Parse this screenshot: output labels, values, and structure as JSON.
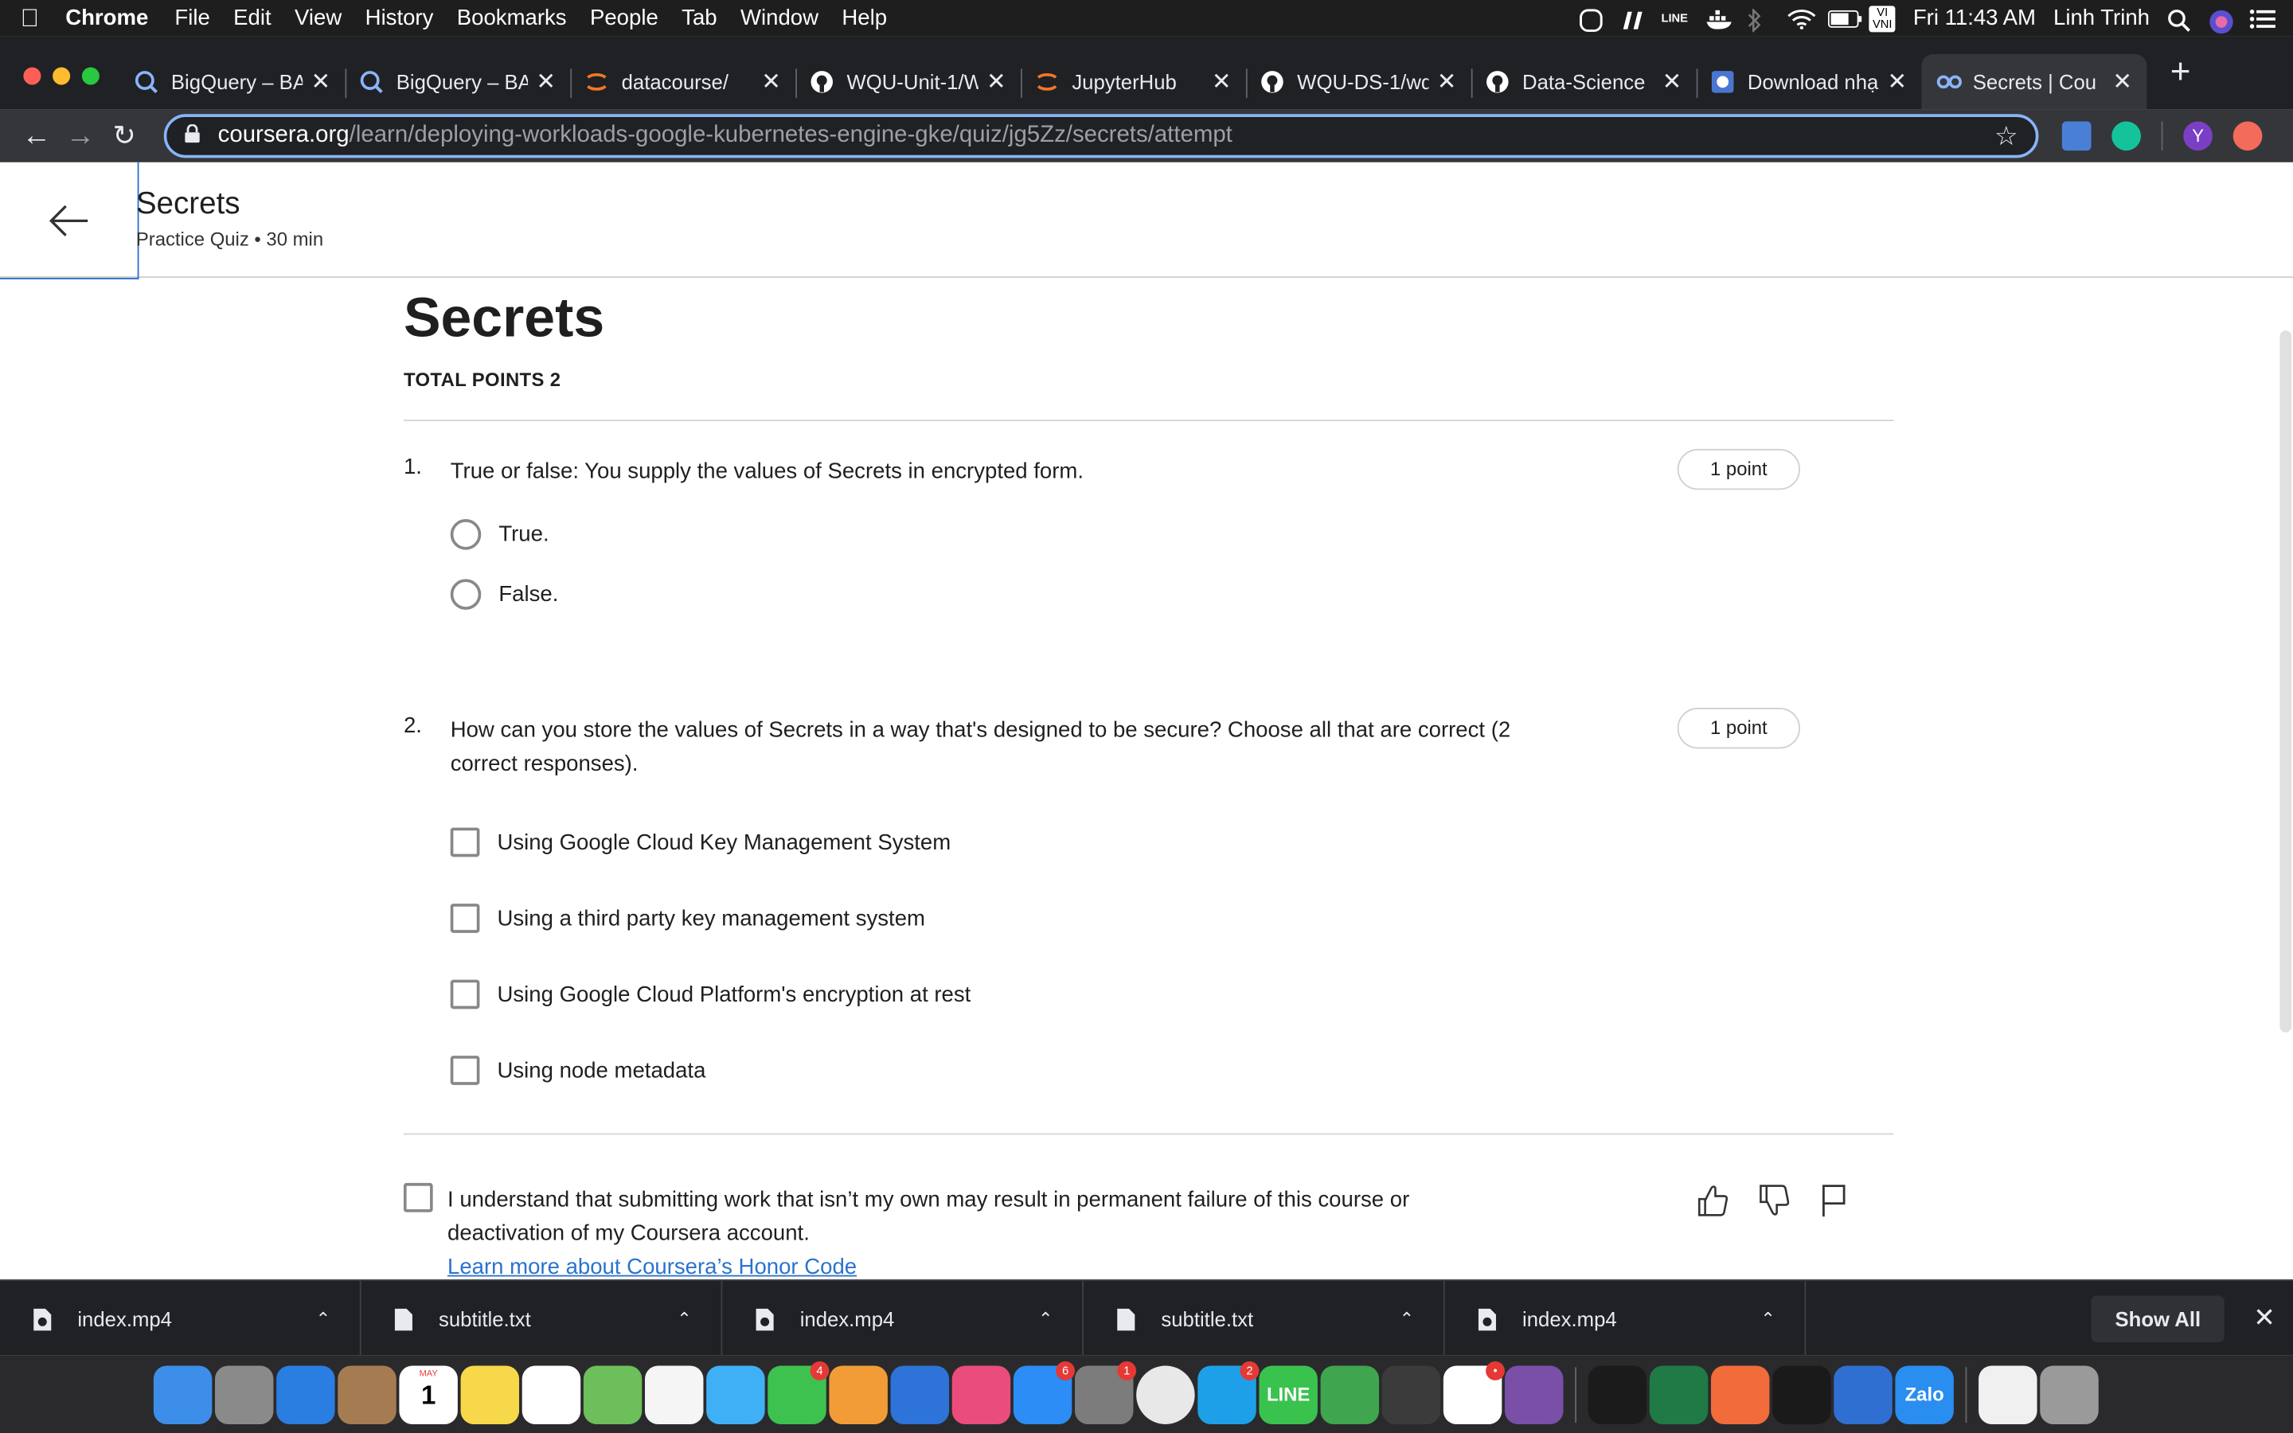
{
  "menubar": {
    "app": "Chrome",
    "items": [
      "File",
      "Edit",
      "View",
      "History",
      "Bookmarks",
      "People",
      "Tab",
      "Window",
      "Help"
    ],
    "clock": "Fri 11:43 AM",
    "user": "Linh Trinh",
    "input_source": "VI VNI",
    "line_label": "LINE"
  },
  "tabs": [
    {
      "title": "BigQuery – BA",
      "icon": "bigquery-icon",
      "color": "#8ab4f8"
    },
    {
      "title": "BigQuery – BA",
      "icon": "bigquery-icon",
      "color": "#8ab4f8"
    },
    {
      "title": "datacourse/",
      "icon": "jupyter-icon",
      "color": "#f37626"
    },
    {
      "title": "WQU-Unit-1/W",
      "icon": "github-icon",
      "color": "#ffffff"
    },
    {
      "title": "JupyterHub",
      "icon": "jupyter-icon",
      "color": "#f37626"
    },
    {
      "title": "WQU-DS-1/wq",
      "icon": "github-icon",
      "color": "#ffffff"
    },
    {
      "title": "Data-Science",
      "icon": "github-icon",
      "color": "#ffffff"
    },
    {
      "title": "Download nhạ",
      "icon": "music-icon",
      "color": "#4a76d1"
    },
    {
      "title": "Secrets | Cou",
      "icon": "coursera-icon",
      "color": "#8ab4f8"
    }
  ],
  "address": {
    "host": "coursera.org",
    "path": "/learn/deploying-workloads-google-kubernetes-engine-gke/quiz/jg5Zz/secrets/attempt"
  },
  "profile_initial": "Y",
  "header": {
    "title": "Secrets",
    "subtitle": "Practice Quiz • 30 min"
  },
  "quiz": {
    "title": "Secrets",
    "total_points": "TOTAL POINTS 2",
    "questions": [
      {
        "number": "1.",
        "text": "True or false: You supply the values of Secrets in encrypted form.",
        "points": "1 point",
        "options": [
          "True.",
          "False."
        ]
      },
      {
        "number": "2.",
        "text": "How can you store the values of Secrets in a way that's designed to be secure? Choose all that are correct (2 correct responses).",
        "points": "1 point",
        "options": [
          "Using Google Cloud Key Management System",
          "Using a third party key management system",
          "Using Google Cloud Platform's encryption at rest",
          "Using node metadata"
        ]
      }
    ],
    "honor_text": "I understand that submitting work that isn’t my own may result in permanent failure of this course or deactivation of my Coursera account.",
    "honor_link": "Learn more about Coursera’s Honor Code"
  },
  "downloads": {
    "items": [
      "index.mp4",
      "subtitle.txt",
      "index.mp4",
      "subtitle.txt",
      "index.mp4"
    ],
    "show_all": "Show All"
  },
  "dock": {
    "apps": [
      {
        "name": "finder",
        "color": "#3d8ee8"
      },
      {
        "name": "launchpad",
        "color": "#8a8a8a"
      },
      {
        "name": "safari",
        "color": "#2a7de1"
      },
      {
        "name": "contacts",
        "color": "#a57c52"
      },
      {
        "name": "calendar",
        "color": "#ffffff",
        "text": "1",
        "month": "MAY"
      },
      {
        "name": "notes",
        "color": "#f7d84a"
      },
      {
        "name": "reminders",
        "color": "#ffffff"
      },
      {
        "name": "maps",
        "color": "#6cbf5a"
      },
      {
        "name": "photos",
        "color": "#f5f5f5"
      },
      {
        "name": "messages",
        "color": "#3fb0f5"
      },
      {
        "name": "facetime",
        "color": "#3dc24f",
        "badge": "4"
      },
      {
        "name": "pages",
        "color": "#f29c38"
      },
      {
        "name": "keynote",
        "color": "#2d73d8"
      },
      {
        "name": "itunes",
        "color": "#ea4c7b"
      },
      {
        "name": "app-store",
        "color": "#2b8df5",
        "badge": "6"
      },
      {
        "name": "system-preferences",
        "color": "#7c7c7c",
        "badge": "1"
      },
      {
        "name": "chrome",
        "color": "#e8e8e8"
      },
      {
        "name": "skype",
        "color": "#1ea0e8",
        "badge": "2"
      },
      {
        "name": "line",
        "color": "#3ac24f",
        "text": "LINE"
      },
      {
        "name": "turtle",
        "color": "#3fa54f"
      },
      {
        "name": "sublime",
        "color": "#3b3b3b"
      },
      {
        "name": "slack",
        "color": "#ffffff",
        "badge": "•"
      },
      {
        "name": "github-desktop",
        "color": "#7a4fa8"
      },
      {
        "name": "activity",
        "color": "#1b1b1b"
      },
      {
        "name": "excel",
        "color": "#1f7a45"
      },
      {
        "name": "postman",
        "color": "#f26b3a"
      },
      {
        "name": "terminal",
        "color": "#1a1a1a"
      },
      {
        "name": "wqu",
        "color": "#2f6fd1"
      },
      {
        "name": "zalo",
        "color": "#2a8df0",
        "text": "Zalo"
      },
      {
        "name": "document",
        "color": "#f0f0f0"
      },
      {
        "name": "trash",
        "color": "#9a9a9a"
      }
    ]
  },
  "colors": {
    "link": "#2a73cc",
    "chrome_dark": "#202124",
    "omnibox_focus": "#8ab4f8"
  }
}
